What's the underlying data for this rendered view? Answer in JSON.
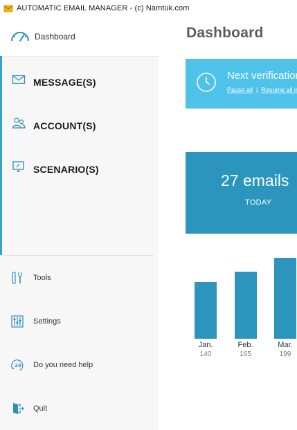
{
  "window": {
    "title": "AUTOMATIC EMAIL MANAGER - (c) Namtuk.com"
  },
  "sidebar": {
    "dashboard": {
      "label": "Dashboard",
      "icon": "gauge-icon"
    },
    "nav_items": [
      {
        "label": "MESSAGE(S)",
        "icon": "envelope-icon"
      },
      {
        "label": "ACCOUNT(S)",
        "icon": "users-icon"
      },
      {
        "label": "SCENARIO(S)",
        "icon": "monitor-icon"
      }
    ],
    "tool_items": [
      {
        "label": "Tools",
        "icon": "tools-icon"
      },
      {
        "label": "Settings",
        "icon": "settings-icon"
      },
      {
        "label": "Do you need help",
        "icon": "help-24-icon"
      },
      {
        "label": "Quit",
        "icon": "exit-icon"
      }
    ]
  },
  "main": {
    "page_title": "Dashboard",
    "verification": {
      "title": "Next verification",
      "pause_label": "Pause all",
      "separator": "|",
      "resume_label": "Resume all now"
    },
    "stats": {
      "value": "27 emails",
      "period": "TODAY"
    }
  },
  "colors": {
    "accent": "#35a3cf",
    "banner": "#4fc2ea",
    "card": "#2b95bd",
    "bar": "#2b95bd"
  },
  "chart_data": {
    "type": "bar",
    "categories": [
      "Jan.",
      "Feb.",
      "Mar."
    ],
    "values": [
      140,
      165,
      199
    ]
  }
}
